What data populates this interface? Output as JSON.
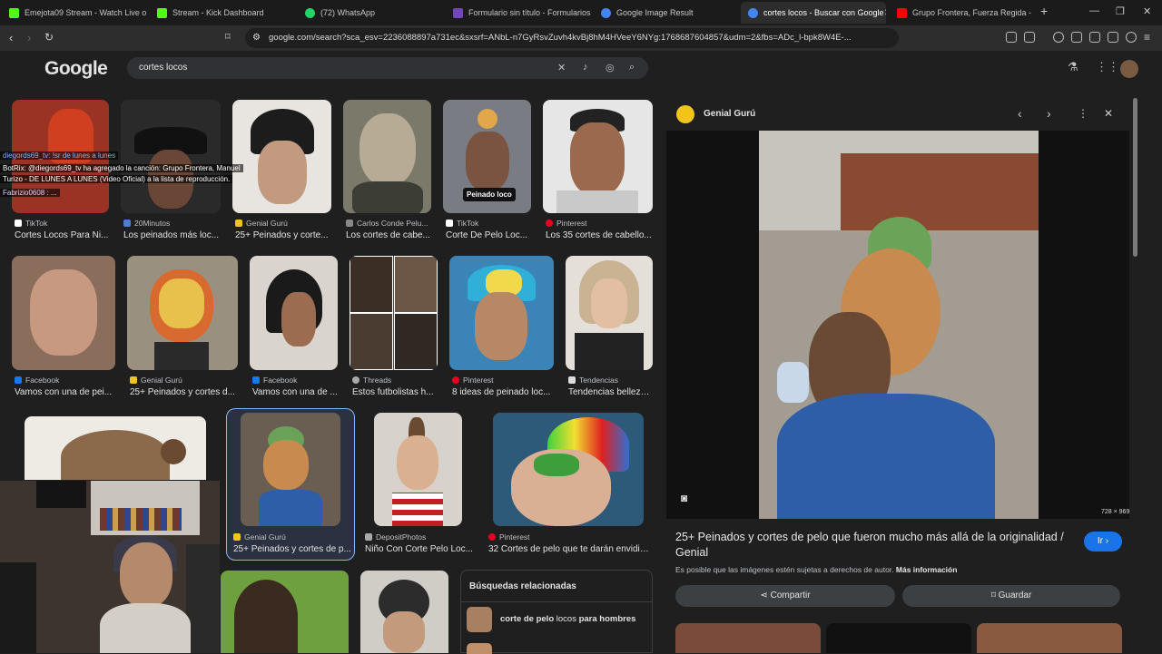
{
  "tabs": [
    {
      "title": "Emejota09 Stream - Watch Live o",
      "color": "#53fc18"
    },
    {
      "title": "Stream - Kick Dashboard",
      "color": "#53fc18"
    },
    {
      "title": "(72) WhatsApp",
      "color": "#25d366"
    },
    {
      "title": "Formulario sin título - Formularios de",
      "color": "#7248b9"
    },
    {
      "title": "Google Image Result",
      "color": "#4285f4"
    },
    {
      "title": "cortes locos - Buscar con Google",
      "color": "#4285f4"
    },
    {
      "title": "Grupo Frontera, Fuerza Regida -",
      "color": "#ff0000"
    }
  ],
  "address": {
    "url": "google.com/search?sca_esv=2236088897a731ec&sxsrf=ANbL-n7GyRsvZuvh4kvBj8hM4HVeeY6NYg:1768687604857&udm=2&fbs=ADc_l-bpk8W4E-..."
  },
  "search": {
    "logo": "Google",
    "query": "cortes locos"
  },
  "results": [
    {
      "source": "TikTok",
      "title": "Cortes Locos Para Ni...",
      "color": "#9a3324",
      "src_color": "#ffffff"
    },
    {
      "source": "20Minutos",
      "title": "Los peinados más loc...",
      "color": "#2a2a2a",
      "src_color": "#4f7bd9"
    },
    {
      "source": "Genial Gurú",
      "title": "25+ Peinados y corte...",
      "color": "#c8c2bb",
      "src_color": "#f0c419"
    },
    {
      "source": "Carlos Conde Pelu...",
      "title": "Los cortes de cabe...",
      "color": "#7b7a6a",
      "src_color": "#888888"
    },
    {
      "source": "TikTok",
      "title": "Corte De Pelo Loc...",
      "color": "#7a7c84",
      "src_color": "#ffffff"
    },
    {
      "source": "Pinterest",
      "title": "Los 35 cortes de cabello...",
      "color": "#8d6e5a",
      "src_color": "#e60023"
    },
    {
      "source": "Facebook",
      "title": "Vamos con una de pei...",
      "color": "#8b6d5c",
      "src_color": "#1877f2"
    },
    {
      "source": "Genial Gurú",
      "title": "25+ Peinados y cortes d...",
      "color": "#b15a3a",
      "src_color": "#f0c419"
    },
    {
      "source": "Facebook",
      "title": "Vamos con una de ...",
      "color": "#d9d4ce",
      "src_color": "#1877f2"
    },
    {
      "source": "Threads",
      "title": "Estos futbolistas h...",
      "color": "#5b4a3e",
      "src_color": "#aaaaaa"
    },
    {
      "source": "Pinterest",
      "title": "8 ideas de peinado loc...",
      "color": "#3a84b8",
      "src_color": "#e60023"
    },
    {
      "source": "Tendencias",
      "title": "Tendencias belleza...",
      "color": "#c9b393",
      "src_color": "#dddddd"
    },
    {
      "source": "Genial Gurú",
      "title": "25+ Peinados y cortes de p...",
      "color": "#6a5e52",
      "src_color": "#f0c419"
    },
    {
      "source": "DepositPhotos",
      "title": "Niño Con Corte Pelo Loc...",
      "color": "#d7d2cc",
      "src_color": "#aaaaaa"
    },
    {
      "source": "Pinterest",
      "title": "32 Cortes de pelo que te darán envidia ...",
      "color": "#3d9e3c",
      "src_color": "#e60023"
    }
  ],
  "badge": {
    "label": "Peinado loco"
  },
  "related": {
    "title": "Búsquedas relacionadas",
    "item_pre": "corte de pelo ",
    "item_mid": "locos",
    "item_post": " para hombres"
  },
  "chat": {
    "line1": "diegords69_tv: !sr de lunes a lunes",
    "line2": "BotRix: @diegords69_tv ha agregado la canción: Grupo Frontera, Manuel",
    "line3": "Turizo - DE LUNES A LUNES (Video Oficial) a la lista de reproducción.",
    "line4": "Fabrizio0608 : ..."
  },
  "panel": {
    "source": "Genial Gurú",
    "dims": "728 × 969",
    "title": "25+ Peinados y cortes de pelo que fueron mucho más allá de la originalidad / Genial",
    "visit": "Ir",
    "notice": "Es posible que las imágenes estén sujetas a derechos de autor.",
    "more": "Más información",
    "share": "Compartir",
    "save": "Guardar"
  }
}
